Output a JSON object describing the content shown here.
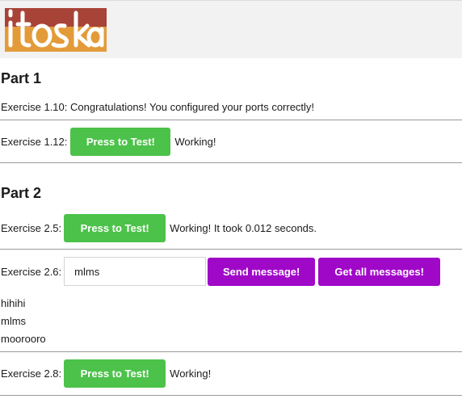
{
  "logo": {
    "alt": "itoska"
  },
  "part1": {
    "heading": "Part 1",
    "ex110": {
      "text": "Exercise 1.10: Congratulations! You configured your ports correctly!"
    },
    "ex112": {
      "label": "Exercise 1.12:",
      "button": "Press to Test!",
      "status": "Working!"
    }
  },
  "part2": {
    "heading": "Part 2",
    "ex25": {
      "label": "Exercise 2.5:",
      "button": "Press to Test!",
      "status": "Working! It took 0.012 seconds."
    },
    "ex26": {
      "label": "Exercise 2.6:",
      "input_value": "mlms",
      "send_button": "Send message!",
      "get_button": "Get all messages!",
      "messages": [
        "hihihi",
        "mlms",
        "moorooro"
      ]
    },
    "ex28": {
      "label": "Exercise 2.8:",
      "button": "Press to Test!",
      "status": "Working!"
    }
  },
  "colors": {
    "green": "#4cc24a",
    "purple": "#a008c8",
    "logo_dark": "#a84338",
    "logo_orange": "#e39b3a"
  }
}
